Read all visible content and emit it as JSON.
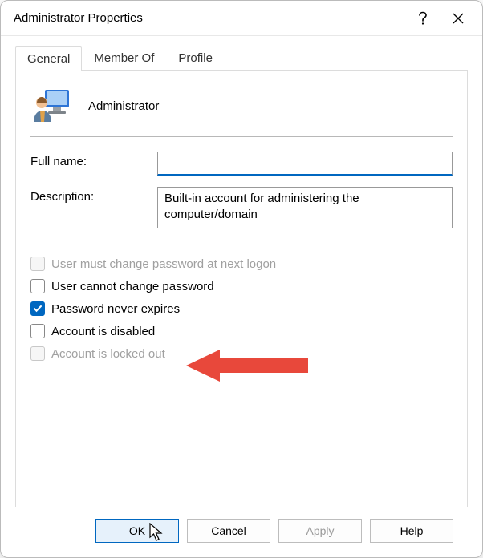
{
  "window": {
    "title": "Administrator Properties"
  },
  "tabs": {
    "general": "General",
    "member_of": "Member Of",
    "profile": "Profile",
    "active": "general"
  },
  "user": {
    "display_name": "Administrator"
  },
  "fields": {
    "full_name_label": "Full name:",
    "full_name_value": "",
    "description_label": "Description:",
    "description_value": "Built-in account for administering the computer/domain"
  },
  "checkboxes": {
    "must_change": {
      "label": "User must change password at next logon",
      "checked": false,
      "enabled": false
    },
    "cannot_change": {
      "label": "User cannot change password",
      "checked": false,
      "enabled": true
    },
    "never_expires": {
      "label": "Password never expires",
      "checked": true,
      "enabled": true
    },
    "disabled": {
      "label": "Account is disabled",
      "checked": false,
      "enabled": true
    },
    "locked_out": {
      "label": "Account is locked out",
      "checked": false,
      "enabled": false
    }
  },
  "buttons": {
    "ok": "OK",
    "cancel": "Cancel",
    "apply": "Apply",
    "help": "Help"
  },
  "annotation": {
    "arrow_color": "#e8483b"
  }
}
